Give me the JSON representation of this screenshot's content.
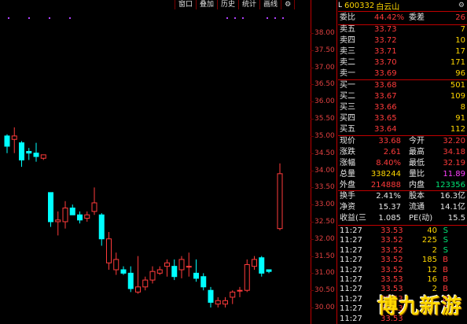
{
  "toolbar": {
    "items": [
      {
        "label": "窗口"
      },
      {
        "label": "叠加"
      },
      {
        "label": "历史"
      },
      {
        "label": "统计"
      },
      {
        "label": "画线"
      }
    ],
    "gear_icon": "gear-icon"
  },
  "chart_data": {
    "type": "candlestick",
    "ylim": [
      29.8,
      38.3
    ],
    "y_ticks": [
      "38.00",
      "37.50",
      "37.00",
      "36.50",
      "36.00",
      "35.50",
      "35.00",
      "34.50",
      "34.00",
      "33.50",
      "33.00",
      "32.50",
      "32.00",
      "31.50",
      "31.00",
      "30.50",
      "30.00"
    ],
    "up_color": "#ff3b3b",
    "down_color": "#00ffff",
    "candles": [
      {
        "o": 35.0,
        "h": 35.05,
        "l": 34.5,
        "c": 34.7
      },
      {
        "o": 34.9,
        "h": 35.25,
        "l": 34.5,
        "c": 35.0
      },
      {
        "o": 34.8,
        "h": 34.85,
        "l": 34.1,
        "c": 34.3
      },
      {
        "o": 34.55,
        "h": 34.65,
        "l": 34.3,
        "c": 34.5
      },
      {
        "o": 34.5,
        "h": 34.8,
        "l": 34.25,
        "c": 34.4
      },
      {
        "o": 34.35,
        "h": 34.45,
        "l": 34.3,
        "c": 34.45
      },
      {
        "o": 33.35,
        "h": 33.35,
        "l": 32.35,
        "c": 32.5
      },
      {
        "o": 32.5,
        "h": 32.8,
        "l": 32.1,
        "c": 32.55
      },
      {
        "o": 32.5,
        "h": 33.1,
        "l": 32.3,
        "c": 32.9
      },
      {
        "o": 32.9,
        "h": 33.0,
        "l": 32.7,
        "c": 32.7
      },
      {
        "o": 32.7,
        "h": 32.8,
        "l": 32.45,
        "c": 32.55
      },
      {
        "o": 32.6,
        "h": 32.8,
        "l": 32.5,
        "c": 32.7
      },
      {
        "o": 32.8,
        "h": 33.5,
        "l": 32.7,
        "c": 33.05
      },
      {
        "o": 32.7,
        "h": 32.75,
        "l": 31.8,
        "c": 32.0
      },
      {
        "o": 31.3,
        "h": 32.2,
        "l": 31.1,
        "c": 32.0
      },
      {
        "o": 31.1,
        "h": 31.6,
        "l": 30.95,
        "c": 31.4
      },
      {
        "o": 31.1,
        "h": 31.2,
        "l": 30.95,
        "c": 31.0
      },
      {
        "o": 31.0,
        "h": 31.2,
        "l": 30.45,
        "c": 30.55
      },
      {
        "o": 30.45,
        "h": 31.5,
        "l": 30.4,
        "c": 30.6
      },
      {
        "o": 30.6,
        "h": 30.9,
        "l": 30.5,
        "c": 30.8
      },
      {
        "o": 30.8,
        "h": 31.2,
        "l": 30.7,
        "c": 31.05
      },
      {
        "o": 31.0,
        "h": 31.2,
        "l": 30.95,
        "c": 31.1
      },
      {
        "o": 31.2,
        "h": 31.4,
        "l": 30.9,
        "c": 31.3
      },
      {
        "o": 31.2,
        "h": 31.4,
        "l": 30.8,
        "c": 30.9
      },
      {
        "o": 31.1,
        "h": 31.5,
        "l": 30.85,
        "c": 31.4
      },
      {
        "o": 31.2,
        "h": 31.6,
        "l": 30.9,
        "c": 31.2
      },
      {
        "o": 31.0,
        "h": 31.4,
        "l": 30.75,
        "c": 30.85
      },
      {
        "o": 30.9,
        "h": 31.0,
        "l": 30.5,
        "c": 30.6
      },
      {
        "o": 30.5,
        "h": 30.6,
        "l": 30.0,
        "c": 30.15
      },
      {
        "o": 30.1,
        "h": 30.3,
        "l": 30.0,
        "c": 30.2
      },
      {
        "o": 30.1,
        "h": 30.3,
        "l": 30.0,
        "c": 30.2
      },
      {
        "o": 30.3,
        "h": 30.5,
        "l": 30.1,
        "c": 30.45
      },
      {
        "o": 30.5,
        "h": 30.6,
        "l": 30.3,
        "c": 30.5
      },
      {
        "o": 30.5,
        "h": 31.4,
        "l": 30.45,
        "c": 31.25
      },
      {
        "o": 31.2,
        "h": 31.5,
        "l": 31.1,
        "c": 31.4
      },
      {
        "o": 31.45,
        "h": 31.5,
        "l": 30.9,
        "c": 31.0
      },
      {
        "o": 31.1,
        "h": 31.1,
        "l": 31.0,
        "c": 31.05
      },
      {
        "o": 32.3,
        "h": 34.2,
        "l": 32.25,
        "c": 33.9
      }
    ]
  },
  "panel": {
    "header": {
      "prefix": "L",
      "code": "600332",
      "name": "白云山"
    },
    "weibi": {
      "label": "委比",
      "value": "44.42%",
      "label2": "委差",
      "value2": "26"
    },
    "asks": [
      {
        "label": "卖五",
        "price": "33.73",
        "vol": "7"
      },
      {
        "label": "卖四",
        "price": "33.72",
        "vol": "10"
      },
      {
        "label": "卖三",
        "price": "33.71",
        "vol": "17"
      },
      {
        "label": "卖二",
        "price": "33.70",
        "vol": "171"
      },
      {
        "label": "卖一",
        "price": "33.69",
        "vol": "96"
      }
    ],
    "bids": [
      {
        "label": "买一",
        "price": "33.68",
        "vol": "501"
      },
      {
        "label": "买二",
        "price": "33.67",
        "vol": "109"
      },
      {
        "label": "买三",
        "price": "33.66",
        "vol": "8"
      },
      {
        "label": "买四",
        "price": "33.65",
        "vol": "91"
      },
      {
        "label": "买五",
        "price": "33.64",
        "vol": "112"
      }
    ],
    "quote": [
      {
        "l1": "现价",
        "v1": "33.68",
        "l2": "今开",
        "v2": "32.20"
      },
      {
        "l1": "涨跌",
        "v1": "2.61",
        "l2": "最高",
        "v2": "34.18"
      },
      {
        "l1": "涨幅",
        "v1": "8.40%",
        "l2": "最低",
        "v2": "32.19"
      },
      {
        "l1": "总量",
        "v1": "338244",
        "l2": "量比",
        "v2": "11.89"
      },
      {
        "l1": "外盘",
        "v1": "214888",
        "l2": "内盘",
        "v2": "123356"
      }
    ],
    "stats": [
      {
        "l1": "换手",
        "v1": "2.41%",
        "l2": "股本",
        "v2": "16.3亿"
      },
      {
        "l1": "净资",
        "v1": "15.37",
        "l2": "流通",
        "v2": "14.1亿"
      },
      {
        "l1": "收益(三",
        "v1": "1.085",
        "l2": "PE(动)",
        "v2": "15.5"
      }
    ],
    "ticks": [
      {
        "time": "11:27",
        "price": "33.53",
        "vol": "40",
        "side": "S"
      },
      {
        "time": "11:27",
        "price": "33.52",
        "vol": "225",
        "side": "S"
      },
      {
        "time": "11:27",
        "price": "33.52",
        "vol": "2",
        "side": "S"
      },
      {
        "time": "11:27",
        "price": "33.52",
        "vol": "185",
        "side": "B"
      },
      {
        "time": "11:27",
        "price": "33.52",
        "vol": "12",
        "side": "B"
      },
      {
        "time": "11:27",
        "price": "33.53",
        "vol": "16",
        "side": "B"
      },
      {
        "time": "11:27",
        "price": "33.53",
        "vol": "2",
        "side": "B"
      },
      {
        "time": "11:27",
        "price": "33.53",
        "vol": "",
        "side": "B"
      },
      {
        "time": "11:27",
        "price": "33.53",
        "vol": "",
        "side": "B"
      },
      {
        "time": "11:27",
        "price": "33.53",
        "vol": "",
        "side": ""
      }
    ],
    "watermark": "博九新游"
  }
}
